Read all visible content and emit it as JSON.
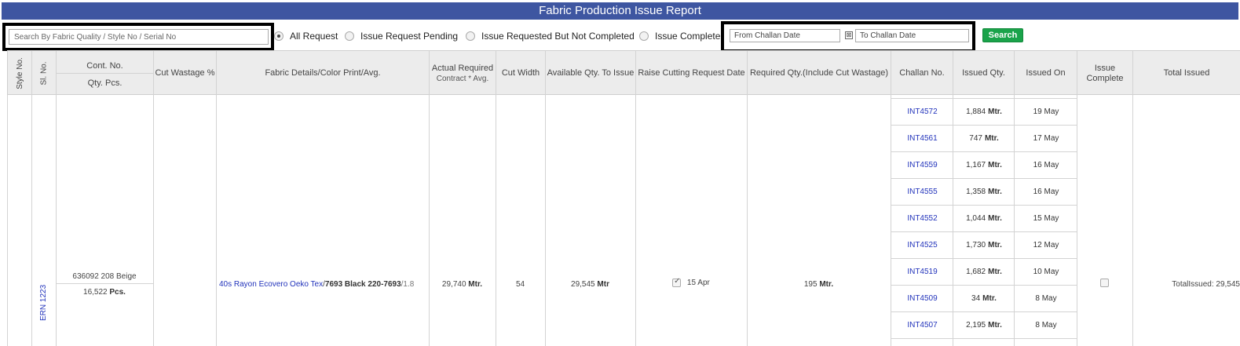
{
  "title": "Fabric Production Issue Report",
  "filters": {
    "search_placeholder": "Search By Fabric Quality / Style No / Serial No",
    "radios": [
      {
        "label": "All Request",
        "checked": true
      },
      {
        "label": "Issue Request Pending",
        "checked": false
      },
      {
        "label": "Issue Requested But Not Completed",
        "checked": false
      },
      {
        "label": "Issue Complete",
        "checked": false
      }
    ],
    "from_date_placeholder": "From Challan Date",
    "to_date_placeholder": "To Challan Date",
    "clear_glyph": "⊠",
    "search_button": "Search"
  },
  "columns": {
    "style_no": "Style No.",
    "sl_no": "Sl. No.",
    "cont_no": "Cont. No.",
    "qty_pcs": "Qty. Pcs.",
    "cut_wastage": "Cut Wastage %",
    "fabric_details": "Fabric Details/Color Print/Avg.",
    "actual_required": "Actual Required",
    "actual_required_sub": "Contract * Avg.",
    "cut_width": "Cut Width",
    "available_qty": "Available Qty. To Issue",
    "raise_cutting": "Raise Cutting Request Date",
    "required_qty": "Required Qty.(Include Cut Wastage)",
    "challan_no": "Challan No.",
    "issued_qty": "Issued Qty.",
    "issued_on": "Issued On",
    "issue_complete_1": "Issue",
    "issue_complete_2": "Complete",
    "total_issued": "Total Issued"
  },
  "row": {
    "sl_no": "ERN 1223",
    "cont_no": "636092 208 Beige",
    "qty_pcs_value": "16,522",
    "qty_pcs_unit": "Pcs.",
    "fabric_quality": "40s Rayon Ecovero Oeko Tex",
    "fabric_sep": "/",
    "color_print": "7693 Black 220-7693",
    "avg": "/1.8",
    "actual_required_value": "29,740",
    "actual_required_unit": "Mtr.",
    "cut_width": "54",
    "available_value": "29,545",
    "available_unit": "Mtr",
    "raise_cutting_checked": true,
    "raise_cutting_date": "15 Apr",
    "required_value": "195",
    "required_unit": "Mtr.",
    "issue_complete_checked": false,
    "total_issued": "TotalIssued: 29,545",
    "challans": [
      {
        "no": "INT4572",
        "qty": "1,884",
        "unit": "Mtr.",
        "date": "19 May"
      },
      {
        "no": "INT4561",
        "qty": "747",
        "unit": "Mtr.",
        "date": "17 May"
      },
      {
        "no": "INT4559",
        "qty": "1,167",
        "unit": "Mtr.",
        "date": "16 May"
      },
      {
        "no": "INT4555",
        "qty": "1,358",
        "unit": "Mtr.",
        "date": "16 May"
      },
      {
        "no": "INT4552",
        "qty": "1,044",
        "unit": "Mtr.",
        "date": "15 May"
      },
      {
        "no": "INT4525",
        "qty": "1,730",
        "unit": "Mtr.",
        "date": "12 May"
      },
      {
        "no": "INT4519",
        "qty": "1,682",
        "unit": "Mtr.",
        "date": "10 May"
      },
      {
        "no": "INT4509",
        "qty": "34",
        "unit": "Mtr.",
        "date": "8 May"
      },
      {
        "no": "INT4507",
        "qty": "2,195",
        "unit": "Mtr.",
        "date": "8 May"
      }
    ]
  }
}
